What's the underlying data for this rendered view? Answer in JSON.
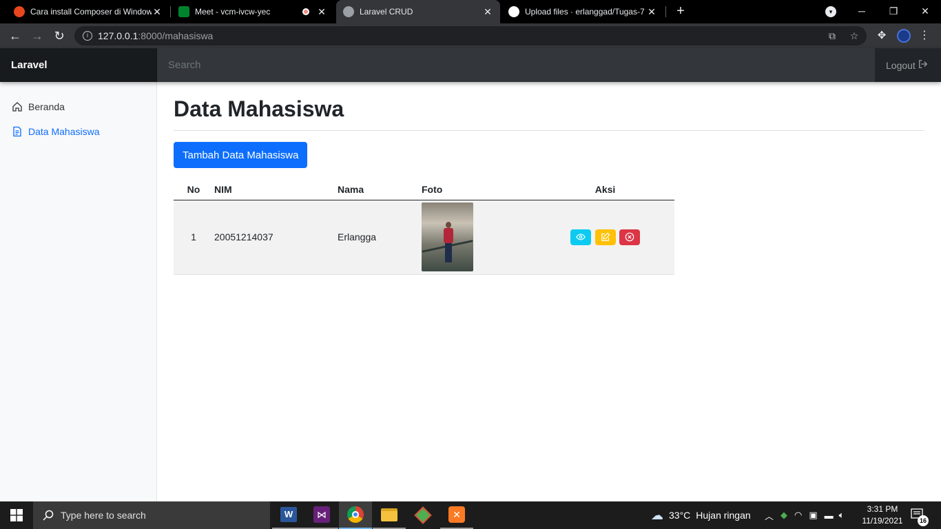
{
  "browser": {
    "tabs": [
      {
        "title": "Cara install Composer di Windows",
        "icon": "red-favicon-icon",
        "active": false
      },
      {
        "title": "Meet - vcm-ivcw-yec",
        "icon": "google-meet-icon",
        "active": false
      },
      {
        "title": "Laravel CRUD",
        "icon": "globe-icon",
        "active": true
      },
      {
        "title": "Upload files · erlanggad/Tugas-7",
        "icon": "github-icon",
        "active": false
      }
    ],
    "address": {
      "host": "127.0.0.1",
      "path": ":8000/mahasiswa"
    }
  },
  "navbar": {
    "brand": "Laravel",
    "search_placeholder": "Search",
    "logout_label": "Logout"
  },
  "sidebar": {
    "items": [
      {
        "label": "Beranda",
        "icon": "home-icon",
        "active": false
      },
      {
        "label": "Data Mahasiswa",
        "icon": "file-text-icon",
        "active": true
      }
    ]
  },
  "main": {
    "title": "Data Mahasiswa",
    "add_button_label": "Tambah Data Mahasiswa",
    "table": {
      "headers": [
        "No",
        "NIM",
        "Nama",
        "Foto",
        "Aksi"
      ],
      "rows": [
        {
          "no": "1",
          "nim": "20051214037",
          "nama": "Erlangga"
        }
      ]
    }
  },
  "taskbar": {
    "search_placeholder": "Type here to search",
    "apps": [
      "word-icon",
      "visual-studio-icon",
      "chrome-icon",
      "file-explorer-icon",
      "git-icon",
      "xampp-icon"
    ],
    "weather_temp": "33°C",
    "weather_text": "Hujan ringan",
    "time": "3:31 PM",
    "date": "11/19/2021",
    "notification_count": "16"
  },
  "colors": {
    "primary": "#0d6efd",
    "info": "#0dcaf0",
    "warning": "#ffc107",
    "danger": "#dc3545",
    "navbar": "#212529"
  }
}
